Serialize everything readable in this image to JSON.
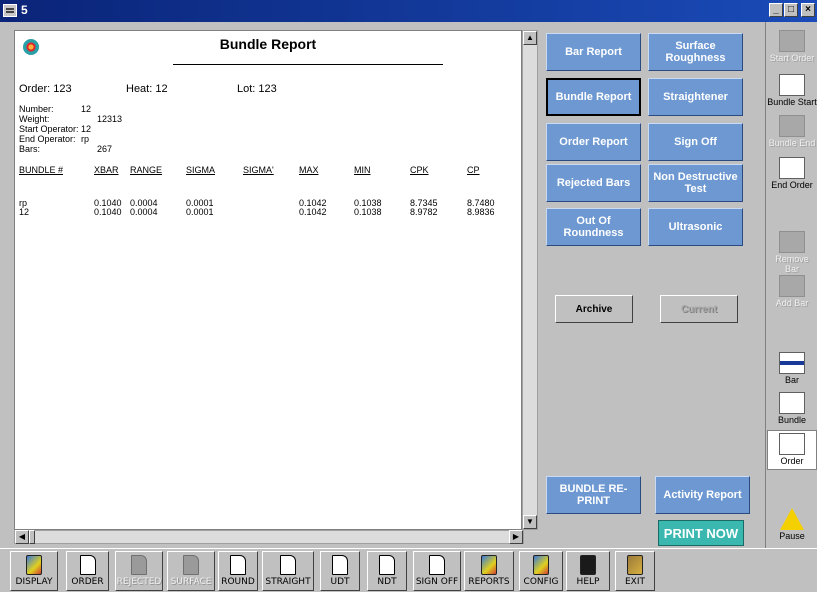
{
  "window": {
    "title": "5",
    "controls": [
      "_",
      "□",
      "×"
    ]
  },
  "report": {
    "title": "Bundle Report",
    "order_label": "Order: 123",
    "heat_label": "Heat: 12",
    "lot_label": "Lot: 123",
    "info_labels": [
      "Number:",
      "Weight:",
      "Start Operator:",
      "End Operator:",
      "Bars:"
    ],
    "info_values": [
      "12",
      "12313",
      "12",
      "rp",
      "267"
    ],
    "columns": [
      "BUNDLE #",
      "XBAR",
      "RANGE",
      "SIGMA",
      "SIGMA'",
      "MAX",
      "MIN",
      "CPK",
      "CP"
    ],
    "rows": [
      [
        "rp",
        "0.1040",
        "0.0004",
        "0.0001",
        "",
        "0.1042",
        "0.1038",
        "8.7345",
        "8.7480"
      ],
      [
        "12",
        "0.1040",
        "0.0004",
        "0.0001",
        "",
        "0.1042",
        "0.1038",
        "8.9782",
        "8.9836"
      ]
    ]
  },
  "actions": {
    "bar_report": "Bar Report",
    "surface_roughness": "Surface Roughness",
    "bundle_report": "Bundle Report",
    "straightener": "Straightener",
    "order_report": "Order Report",
    "sign_off": "Sign Off",
    "rejected_bars": "Rejected Bars",
    "non_destructive_test": "Non Destructive Test",
    "out_of_roundness": "Out Of Roundness",
    "ultrasonic": "Ultrasonic",
    "archive": "Archive",
    "current": "Current",
    "bundle_reprint": "BUNDLE RE-PRINT",
    "activity_report": "Activity Report",
    "print_now": "PRINT NOW"
  },
  "sidebar": {
    "start_order": "Start Order",
    "bundle_start": "Bundle Start",
    "bundle_end": "Bundle End",
    "end_order": "End Order",
    "remove_bar": "Remove Bar",
    "add_bar": "Add Bar",
    "bar": "Bar",
    "bundle": "Bundle",
    "order": "Order",
    "pause": "Pause"
  },
  "toolbar": {
    "display": "DISPLAY",
    "order": "ORDER",
    "rejected": "REJECTED",
    "surface": "SURFACE",
    "round": "ROUND",
    "straight": "STRAIGHT",
    "udt": "UDT",
    "ndt": "NDT",
    "sign_off": "SIGN OFF",
    "reports": "REPORTS",
    "config": "CONFIG",
    "help": "HELP",
    "exit": "EXIT"
  }
}
